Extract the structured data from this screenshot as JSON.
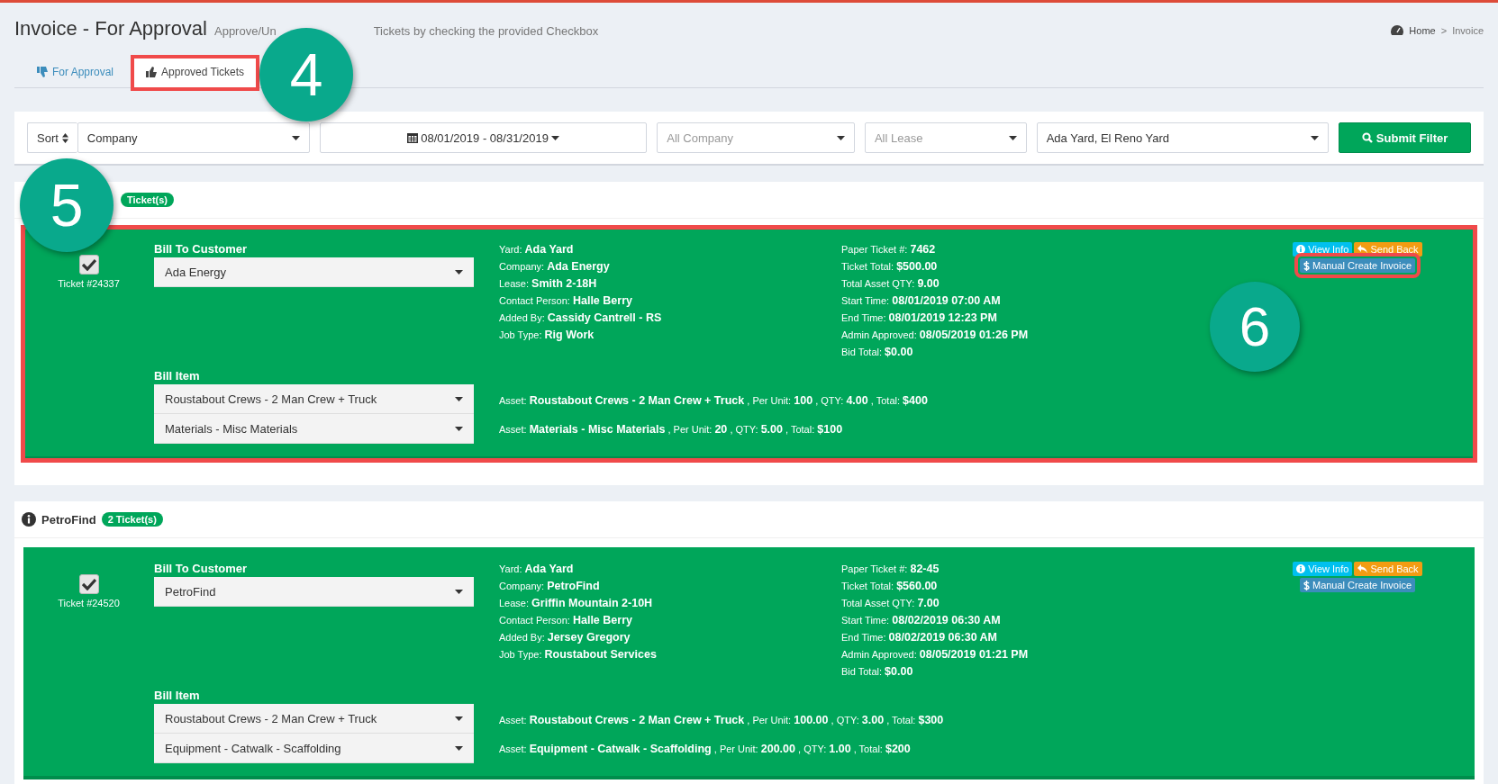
{
  "page": {
    "title": "Invoice - For Approval",
    "subtitle_parts": [
      "Approve/Un",
      "Tickets by checking the provided Checkbox"
    ]
  },
  "breadcrumb": [
    "Home",
    "Invoice"
  ],
  "breadcrumb_separator": ">",
  "tabs": [
    {
      "label": "For Approval",
      "selected": false,
      "highlighted": false
    },
    {
      "label": "Approved Tickets",
      "selected": true,
      "highlighted": true,
      "callout": "4"
    }
  ],
  "filter": {
    "sort": "Sort",
    "company": "Company",
    "date_range": "08/01/2019 - 08/31/2019",
    "company_placeholder": "All Company",
    "lease_placeholder": "All Lease",
    "yard": "Ada Yard, El Reno Yard",
    "submit": "Submit Filter"
  },
  "groups": [
    {
      "badge": "Ticket(s)",
      "callout": "5",
      "tickets": [
        {
          "checked": true,
          "ticket_no": "Ticket #24337",
          "highlighted": true,
          "bill_to_label": "Bill To Customer",
          "customer": "Ada Energy",
          "bill_item_label": "Bill Item",
          "items": [
            "Roustabout Crews - 2 Man Crew + Truck",
            "Materials - Misc Materials"
          ],
          "details_left": [
            "Yard: **Ada Yard**",
            "Company: **Ada Energy**",
            "Lease: **Smith 2-18H**",
            "Contact Person: **Halle Berry**",
            "Added By: **Cassidy Cantrell - RS**",
            "Job Type: **Rig Work**"
          ],
          "details_right": [
            "Paper Ticket #: **7462**",
            "Ticket Total: **$500.00**",
            "Total Asset QTY: **9.00**",
            "Start Time: **08/01/2019 07:00 AM**",
            "End Time: **08/01/2019 12:23 PM**",
            "Admin Approved: **08/05/2019 01:26 PM**",
            "Bid Total: **$0.00**"
          ],
          "assets": [
            "Asset: **Roustabout Crews - 2 Man Crew + Truck** , Per Unit: **100** , QTY: **4.00** , Total: **$400**",
            "Asset: **Materials - Misc Materials** , Per Unit: **20** , QTY: **5.00** , Total: **$100**"
          ],
          "buttons": [
            {
              "label": "View Info",
              "kind": "info",
              "highlighted": false
            },
            {
              "label": "Send Back",
              "kind": "warning",
              "highlighted": false
            },
            {
              "label": "Manual Create Invoice",
              "kind": "primary",
              "highlighted": true,
              "callout": "6"
            }
          ]
        }
      ]
    },
    {
      "name": "PetroFind",
      "badge": "2 Ticket(s)",
      "tickets": [
        {
          "checked": true,
          "ticket_no": "Ticket #24520",
          "highlighted": false,
          "bill_to_label": "Bill To Customer",
          "customer": "PetroFind",
          "bill_item_label": "Bill Item",
          "items": [
            "Roustabout Crews - 2 Man Crew + Truck",
            "Equipment - Catwalk - Scaffolding"
          ],
          "details_left": [
            "Yard: **Ada Yard**",
            "Company: **PetroFind**",
            "Lease: **Griffin Mountain 2-10H**",
            "Contact Person: **Halle Berry**",
            "Added By: **Jersey Gregory**",
            "Job Type: **Roustabout Services**"
          ],
          "details_right": [
            "Paper Ticket #: **82-45**",
            "Ticket Total: **$560.00**",
            "Total Asset QTY: **7.00**",
            "Start Time: **08/02/2019 06:30 AM**",
            "End Time: **08/02/2019 06:30 AM**",
            "Admin Approved: **08/05/2019 01:21 PM**",
            "Bid Total: **$0.00**"
          ],
          "assets": [
            "Asset: **Roustabout Crews - 2 Man Crew + Truck** , Per Unit: **100.00** , QTY: **3.00** , Total: **$300**",
            "Asset: **Equipment - Catwalk - Scaffolding** , Per Unit: **200.00** , QTY: **1.00** , Total: **$200**"
          ],
          "buttons": [
            {
              "label": "View Info",
              "kind": "info",
              "highlighted": false
            },
            {
              "label": "Send Back",
              "kind": "warning",
              "highlighted": false
            },
            {
              "label": "Manual Create Invoice",
              "kind": "primary",
              "highlighted": false
            }
          ]
        }
      ]
    }
  ]
}
